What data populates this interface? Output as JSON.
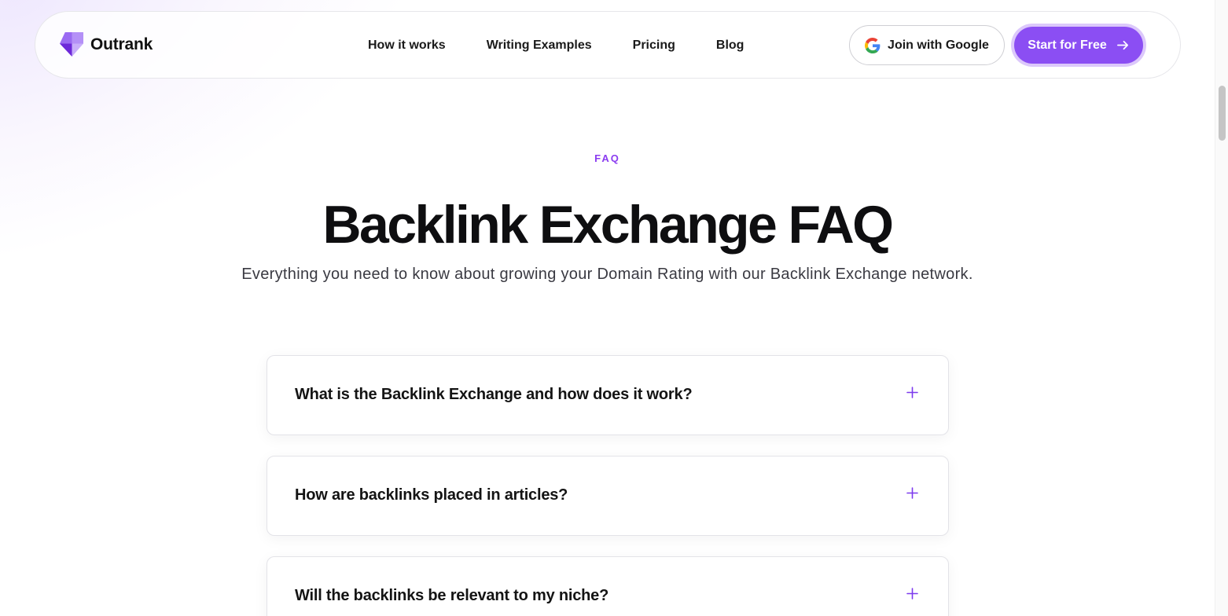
{
  "brand": {
    "name": "Outrank",
    "logo_icon": "outrank-logo-icon"
  },
  "nav": {
    "links": [
      {
        "label": "How it works"
      },
      {
        "label": "Writing Examples"
      },
      {
        "label": "Pricing"
      },
      {
        "label": "Blog"
      }
    ],
    "google_button": {
      "label": "Join with Google",
      "icon": "google-icon"
    },
    "cta_button": {
      "label": "Start for Free",
      "icon": "arrow-right-icon"
    }
  },
  "faq": {
    "eyebrow": "FAQ",
    "title": "Backlink Exchange FAQ",
    "subtitle": "Everything you need to know about growing your Domain Rating with our Backlink Exchange network.",
    "items": [
      {
        "question": "What is the Backlink Exchange and how does it work?",
        "expanded": false
      },
      {
        "question": "How are backlinks placed in articles?",
        "expanded": false
      },
      {
        "question": "Will the backlinks be relevant to my niche?",
        "expanded": false
      }
    ]
  },
  "colors": {
    "accent": "#8b4ef3",
    "accent_text": "#8b3cf0",
    "cta_ring": "#dcc8fb"
  }
}
